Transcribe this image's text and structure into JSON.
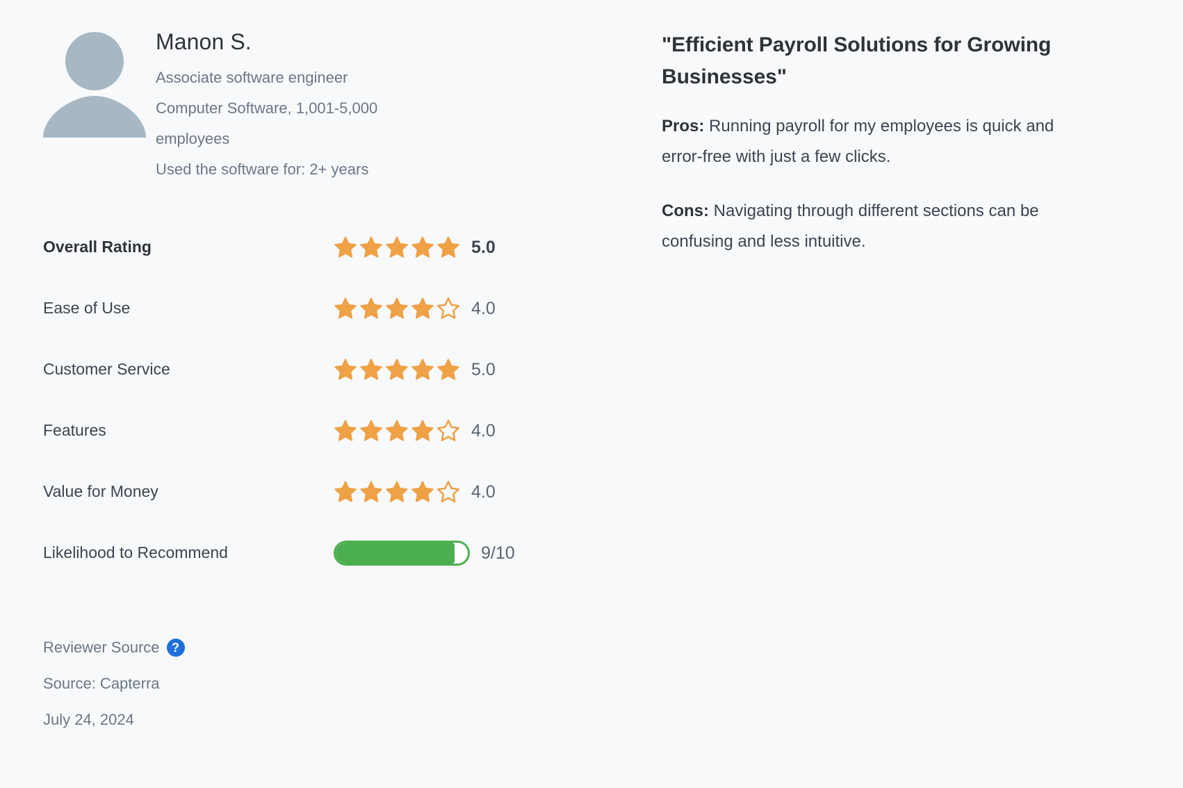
{
  "reviewer": {
    "avatar_icon": "user-avatar-icon",
    "name": "Manon S.",
    "job_title": "Associate software engineer",
    "industry_size": "Computer Software, 1,001-5,000 employees",
    "usage_duration": "Used the software for: 2+ years"
  },
  "ratings": [
    {
      "label": "Overall Rating",
      "value": "5.0",
      "stars": 5,
      "type": "stars"
    },
    {
      "label": "Ease of Use",
      "value": "4.0",
      "stars": 4,
      "type": "stars"
    },
    {
      "label": "Customer Service",
      "value": "5.0",
      "stars": 5,
      "type": "stars"
    },
    {
      "label": "Features",
      "value": "4.0",
      "stars": 4,
      "type": "stars"
    },
    {
      "label": "Value for Money",
      "value": "4.0",
      "stars": 4,
      "type": "stars"
    }
  ],
  "recommend": {
    "label": "Likelihood to Recommend",
    "value": "9/10",
    "score": 9,
    "max": 10,
    "percent": 90
  },
  "source": {
    "reviewer_source_label": "Reviewer Source",
    "help_icon": "?",
    "source_line": "Source: Capterra",
    "date": "July 24, 2024"
  },
  "review": {
    "title": "\"Efficient Payroll Solutions for Growing Businesses\"",
    "pros_label": "Pros:",
    "pros_text": " Running payroll for my employees is quick and error-free with just a few clicks.",
    "cons_label": "Cons:",
    "cons_text": " Navigating through different sections can be confusing and less intuitive."
  },
  "colors": {
    "background": "#f8f9fb",
    "star_filled": "#efa145",
    "star_empty_stroke": "#efa145",
    "progress_green": "#4caf4f",
    "help_blue": "#1e6fd9",
    "avatar_gray": "#a7b8c4",
    "text_dark": "#2f3337",
    "text_muted": "#6b7786"
  }
}
